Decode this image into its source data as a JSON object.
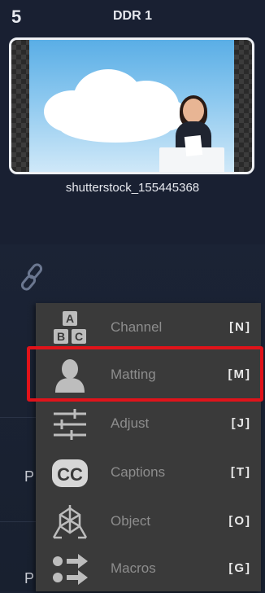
{
  "slot": {
    "number": "5",
    "title": "DDR 1",
    "clip_name": "shutterstock_155445368"
  },
  "background_labels": [
    "P",
    "P"
  ],
  "menu": {
    "items": [
      {
        "label": "Channel",
        "shortcut": "[N]",
        "icon": "abc-channel-icon"
      },
      {
        "label": "Matting",
        "shortcut": "[M]",
        "icon": "person-matting-icon"
      },
      {
        "label": "Adjust",
        "shortcut": "[J]",
        "icon": "sliders-adjust-icon"
      },
      {
        "label": "Captions",
        "shortcut": "[T]",
        "icon": "cc-captions-icon"
      },
      {
        "label": "Object",
        "shortcut": "[O]",
        "icon": "object-3d-icon"
      },
      {
        "label": "Macros",
        "shortcut": "[G]",
        "icon": "macros-icon"
      }
    ],
    "highlighted": "Matting"
  },
  "colors": {
    "panel_bg": "#1b2335",
    "menu_bg": "#3a3a3a",
    "highlight": "#e0131a"
  }
}
